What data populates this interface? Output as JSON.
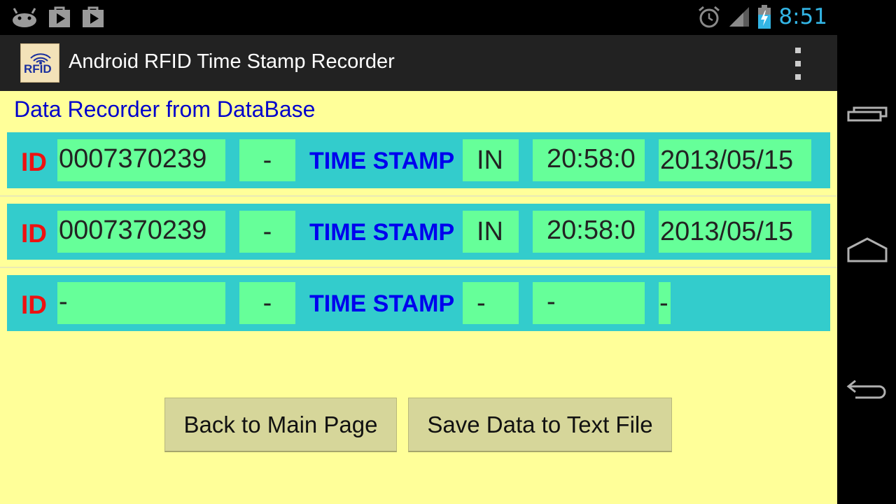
{
  "status_bar": {
    "time": "8:51",
    "icons": [
      "android-debug-icon",
      "play-store-icon",
      "play-store-icon",
      "alarm-icon",
      "signal-icon",
      "battery-charging-icon"
    ]
  },
  "action_bar": {
    "icon_text": "RFID",
    "title": "Android RFID Time Stamp Recorder"
  },
  "content": {
    "section_title": "Data Recorder from DataBase",
    "records": [
      {
        "id_label": "ID",
        "id": "0007370239",
        "sep": "-",
        "ts_label": "TIME STAMP",
        "io": "IN",
        "time": "20:58:0",
        "date": "2013/05/15"
      },
      {
        "id_label": "ID",
        "id": "0007370239",
        "sep": "-",
        "ts_label": "TIME STAMP",
        "io": "IN",
        "time": "20:58:0",
        "date": "2013/05/15"
      },
      {
        "id_label": "ID",
        "id": "-",
        "sep": "-",
        "ts_label": "TIME STAMP",
        "io": "-",
        "time": "-",
        "date": "-"
      }
    ],
    "buttons": {
      "back": "Back to Main Page",
      "save": "Save Data to Text File"
    }
  },
  "colors": {
    "background": "#ffff99",
    "row": "#33cccc",
    "cell": "#66ff99",
    "id_label": "#ee1111",
    "ts_label": "#0000ee",
    "title": "#0000cc",
    "clock": "#33b5e5"
  }
}
